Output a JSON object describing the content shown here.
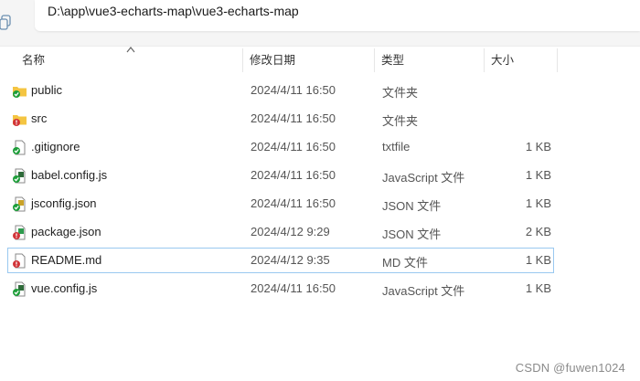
{
  "address_bar": {
    "path": "D:\\app\\vue3-echarts-map\\vue3-echarts-map"
  },
  "columns": {
    "name": "名称",
    "modified": "修改日期",
    "type": "类型",
    "size": "大小",
    "sort": "ascending by name"
  },
  "files": [
    {
      "name": "public",
      "modified": "2024/4/11 16:50",
      "type": "文件夹",
      "size": "",
      "icon": "folder-green-check-icon"
    },
    {
      "name": "src",
      "modified": "2024/4/11 16:50",
      "type": "文件夹",
      "size": "",
      "icon": "folder-red-alert-icon"
    },
    {
      "name": ".gitignore",
      "modified": "2024/4/11 16:50",
      "type": "txtfile",
      "size": "1 KB",
      "icon": "file-green-check-icon"
    },
    {
      "name": "babel.config.js",
      "modified": "2024/4/11 16:50",
      "type": "JavaScript 文件",
      "size": "1 KB",
      "icon": "js-file-green-check-icon"
    },
    {
      "name": "jsconfig.json",
      "modified": "2024/4/11 16:50",
      "type": "JSON 文件",
      "size": "1 KB",
      "icon": "json-file-green-check-icon"
    },
    {
      "name": "package.json",
      "modified": "2024/4/12 9:29",
      "type": "JSON 文件",
      "size": "2 KB",
      "icon": "json-file-red-alert-icon"
    },
    {
      "name": "README.md",
      "modified": "2024/4/12 9:35",
      "type": "MD 文件",
      "size": "1 KB",
      "icon": "file-red-alert-icon",
      "selected": true
    },
    {
      "name": "vue.config.js",
      "modified": "2024/4/11 16:50",
      "type": "JavaScript 文件",
      "size": "1 KB",
      "icon": "js-file-green-check-icon"
    }
  ],
  "watermark": "CSDN @fuwen1024",
  "colors": {
    "green_badge": "#1e9e3a",
    "red_badge": "#d13438",
    "folder": "#f4c542",
    "selection_border": "#99c8f0"
  }
}
